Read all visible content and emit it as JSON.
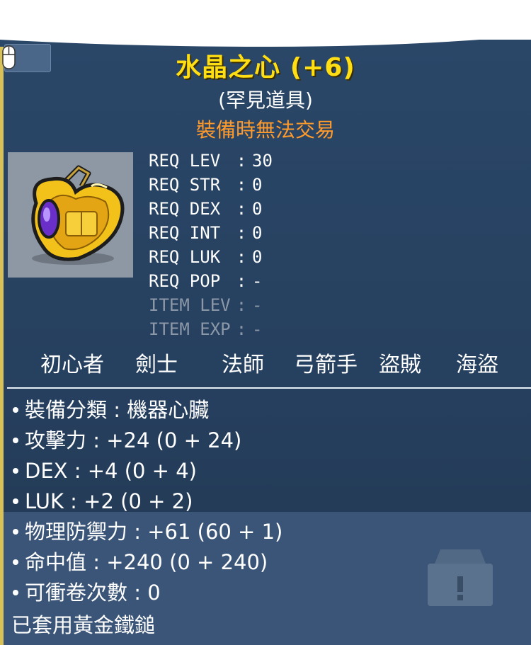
{
  "item": {
    "title": "水晶之心 (+6)",
    "rarity": "(罕見道具)",
    "trade_note": "裝備時無法交易",
    "icon": "crystal-heart-icon"
  },
  "requirements": [
    {
      "label": "REQ LEV",
      "sep": ":",
      "value": "30",
      "dim": false
    },
    {
      "label": "REQ STR",
      "sep": ":",
      "value": "0",
      "dim": false
    },
    {
      "label": "REQ DEX",
      "sep": ":",
      "value": "0",
      "dim": false
    },
    {
      "label": "REQ INT",
      "sep": ":",
      "value": "0",
      "dim": false
    },
    {
      "label": "REQ LUK",
      "sep": ":",
      "value": "0",
      "dim": false
    },
    {
      "label": "REQ POP",
      "sep": ":",
      "value": "-",
      "dim": false
    },
    {
      "label": "ITEM LEV",
      "sep": ":",
      "value": "-",
      "dim": true
    },
    {
      "label": "ITEM EXP",
      "sep": ":",
      "value": "-",
      "dim": true
    }
  ],
  "jobs": [
    "初心者",
    "劍士",
    "法師",
    "弓箭手",
    "盜賊",
    "海盜"
  ],
  "stats": [
    "裝備分類 : 機器心臟",
    "攻擊力 : +24 (0 + 24)",
    "DEX : +4 (0 + 4)",
    "LUK : +2 (0 + 2)",
    "物理防禦力 : +61 (60 + 1)",
    "命中值 : +240 (0 + 240)",
    "可衝卷次數 : 0"
  ],
  "applied_note": "已套用黃金鐵鎚",
  "colors": {
    "title": "#ffde14",
    "trade_note": "#ff9a2c",
    "background": "#2a4768",
    "dim_text": "#8c98a8"
  }
}
